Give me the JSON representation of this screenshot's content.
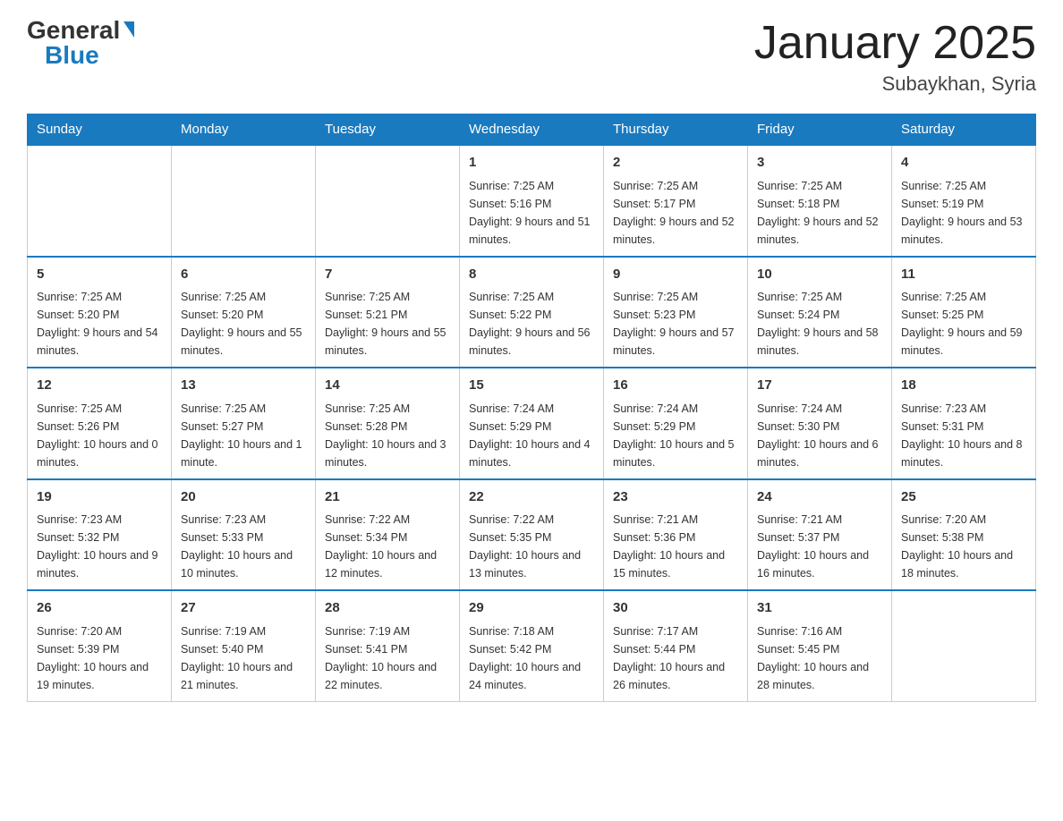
{
  "header": {
    "logo_general": "General",
    "logo_blue": "Blue",
    "month_title": "January 2025",
    "location": "Subaykhan, Syria"
  },
  "weekdays": [
    "Sunday",
    "Monday",
    "Tuesday",
    "Wednesday",
    "Thursday",
    "Friday",
    "Saturday"
  ],
  "weeks": [
    [
      {
        "day": "",
        "sunrise": "",
        "sunset": "",
        "daylight": ""
      },
      {
        "day": "",
        "sunrise": "",
        "sunset": "",
        "daylight": ""
      },
      {
        "day": "",
        "sunrise": "",
        "sunset": "",
        "daylight": ""
      },
      {
        "day": "1",
        "sunrise": "Sunrise: 7:25 AM",
        "sunset": "Sunset: 5:16 PM",
        "daylight": "Daylight: 9 hours and 51 minutes."
      },
      {
        "day": "2",
        "sunrise": "Sunrise: 7:25 AM",
        "sunset": "Sunset: 5:17 PM",
        "daylight": "Daylight: 9 hours and 52 minutes."
      },
      {
        "day": "3",
        "sunrise": "Sunrise: 7:25 AM",
        "sunset": "Sunset: 5:18 PM",
        "daylight": "Daylight: 9 hours and 52 minutes."
      },
      {
        "day": "4",
        "sunrise": "Sunrise: 7:25 AM",
        "sunset": "Sunset: 5:19 PM",
        "daylight": "Daylight: 9 hours and 53 minutes."
      }
    ],
    [
      {
        "day": "5",
        "sunrise": "Sunrise: 7:25 AM",
        "sunset": "Sunset: 5:20 PM",
        "daylight": "Daylight: 9 hours and 54 minutes."
      },
      {
        "day": "6",
        "sunrise": "Sunrise: 7:25 AM",
        "sunset": "Sunset: 5:20 PM",
        "daylight": "Daylight: 9 hours and 55 minutes."
      },
      {
        "day": "7",
        "sunrise": "Sunrise: 7:25 AM",
        "sunset": "Sunset: 5:21 PM",
        "daylight": "Daylight: 9 hours and 55 minutes."
      },
      {
        "day": "8",
        "sunrise": "Sunrise: 7:25 AM",
        "sunset": "Sunset: 5:22 PM",
        "daylight": "Daylight: 9 hours and 56 minutes."
      },
      {
        "day": "9",
        "sunrise": "Sunrise: 7:25 AM",
        "sunset": "Sunset: 5:23 PM",
        "daylight": "Daylight: 9 hours and 57 minutes."
      },
      {
        "day": "10",
        "sunrise": "Sunrise: 7:25 AM",
        "sunset": "Sunset: 5:24 PM",
        "daylight": "Daylight: 9 hours and 58 minutes."
      },
      {
        "day": "11",
        "sunrise": "Sunrise: 7:25 AM",
        "sunset": "Sunset: 5:25 PM",
        "daylight": "Daylight: 9 hours and 59 minutes."
      }
    ],
    [
      {
        "day": "12",
        "sunrise": "Sunrise: 7:25 AM",
        "sunset": "Sunset: 5:26 PM",
        "daylight": "Daylight: 10 hours and 0 minutes."
      },
      {
        "day": "13",
        "sunrise": "Sunrise: 7:25 AM",
        "sunset": "Sunset: 5:27 PM",
        "daylight": "Daylight: 10 hours and 1 minute."
      },
      {
        "day": "14",
        "sunrise": "Sunrise: 7:25 AM",
        "sunset": "Sunset: 5:28 PM",
        "daylight": "Daylight: 10 hours and 3 minutes."
      },
      {
        "day": "15",
        "sunrise": "Sunrise: 7:24 AM",
        "sunset": "Sunset: 5:29 PM",
        "daylight": "Daylight: 10 hours and 4 minutes."
      },
      {
        "day": "16",
        "sunrise": "Sunrise: 7:24 AM",
        "sunset": "Sunset: 5:29 PM",
        "daylight": "Daylight: 10 hours and 5 minutes."
      },
      {
        "day": "17",
        "sunrise": "Sunrise: 7:24 AM",
        "sunset": "Sunset: 5:30 PM",
        "daylight": "Daylight: 10 hours and 6 minutes."
      },
      {
        "day": "18",
        "sunrise": "Sunrise: 7:23 AM",
        "sunset": "Sunset: 5:31 PM",
        "daylight": "Daylight: 10 hours and 8 minutes."
      }
    ],
    [
      {
        "day": "19",
        "sunrise": "Sunrise: 7:23 AM",
        "sunset": "Sunset: 5:32 PM",
        "daylight": "Daylight: 10 hours and 9 minutes."
      },
      {
        "day": "20",
        "sunrise": "Sunrise: 7:23 AM",
        "sunset": "Sunset: 5:33 PM",
        "daylight": "Daylight: 10 hours and 10 minutes."
      },
      {
        "day": "21",
        "sunrise": "Sunrise: 7:22 AM",
        "sunset": "Sunset: 5:34 PM",
        "daylight": "Daylight: 10 hours and 12 minutes."
      },
      {
        "day": "22",
        "sunrise": "Sunrise: 7:22 AM",
        "sunset": "Sunset: 5:35 PM",
        "daylight": "Daylight: 10 hours and 13 minutes."
      },
      {
        "day": "23",
        "sunrise": "Sunrise: 7:21 AM",
        "sunset": "Sunset: 5:36 PM",
        "daylight": "Daylight: 10 hours and 15 minutes."
      },
      {
        "day": "24",
        "sunrise": "Sunrise: 7:21 AM",
        "sunset": "Sunset: 5:37 PM",
        "daylight": "Daylight: 10 hours and 16 minutes."
      },
      {
        "day": "25",
        "sunrise": "Sunrise: 7:20 AM",
        "sunset": "Sunset: 5:38 PM",
        "daylight": "Daylight: 10 hours and 18 minutes."
      }
    ],
    [
      {
        "day": "26",
        "sunrise": "Sunrise: 7:20 AM",
        "sunset": "Sunset: 5:39 PM",
        "daylight": "Daylight: 10 hours and 19 minutes."
      },
      {
        "day": "27",
        "sunrise": "Sunrise: 7:19 AM",
        "sunset": "Sunset: 5:40 PM",
        "daylight": "Daylight: 10 hours and 21 minutes."
      },
      {
        "day": "28",
        "sunrise": "Sunrise: 7:19 AM",
        "sunset": "Sunset: 5:41 PM",
        "daylight": "Daylight: 10 hours and 22 minutes."
      },
      {
        "day": "29",
        "sunrise": "Sunrise: 7:18 AM",
        "sunset": "Sunset: 5:42 PM",
        "daylight": "Daylight: 10 hours and 24 minutes."
      },
      {
        "day": "30",
        "sunrise": "Sunrise: 7:17 AM",
        "sunset": "Sunset: 5:44 PM",
        "daylight": "Daylight: 10 hours and 26 minutes."
      },
      {
        "day": "31",
        "sunrise": "Sunrise: 7:16 AM",
        "sunset": "Sunset: 5:45 PM",
        "daylight": "Daylight: 10 hours and 28 minutes."
      },
      {
        "day": "",
        "sunrise": "",
        "sunset": "",
        "daylight": ""
      }
    ]
  ]
}
